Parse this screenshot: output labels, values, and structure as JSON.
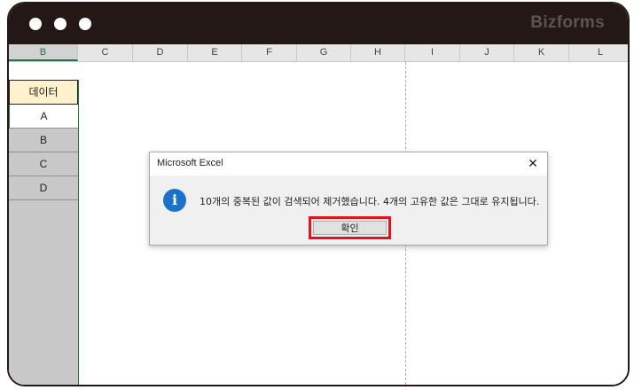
{
  "window": {
    "brand": "Bizforms"
  },
  "columns": [
    "B",
    "C",
    "D",
    "E",
    "F",
    "G",
    "H",
    "I",
    "J",
    "K",
    "L"
  ],
  "selected_column": "B",
  "column_b": {
    "header": "데이터",
    "values": [
      "A",
      "B",
      "C",
      "D"
    ]
  },
  "dialog": {
    "title": "Microsoft Excel",
    "close_glyph": "✕",
    "icon_glyph": "i",
    "message": "10개의 중복된 값이 검색되어 제거했습니다. 4개의 고유한 값은 그대로 유지됩니다.",
    "ok_label": "확인"
  },
  "colors": {
    "titlebar": "#231815",
    "header_fill": "#fff1cc",
    "excel_green": "#217346",
    "highlight_red": "#e0141e",
    "info_blue": "#1a73c8"
  }
}
